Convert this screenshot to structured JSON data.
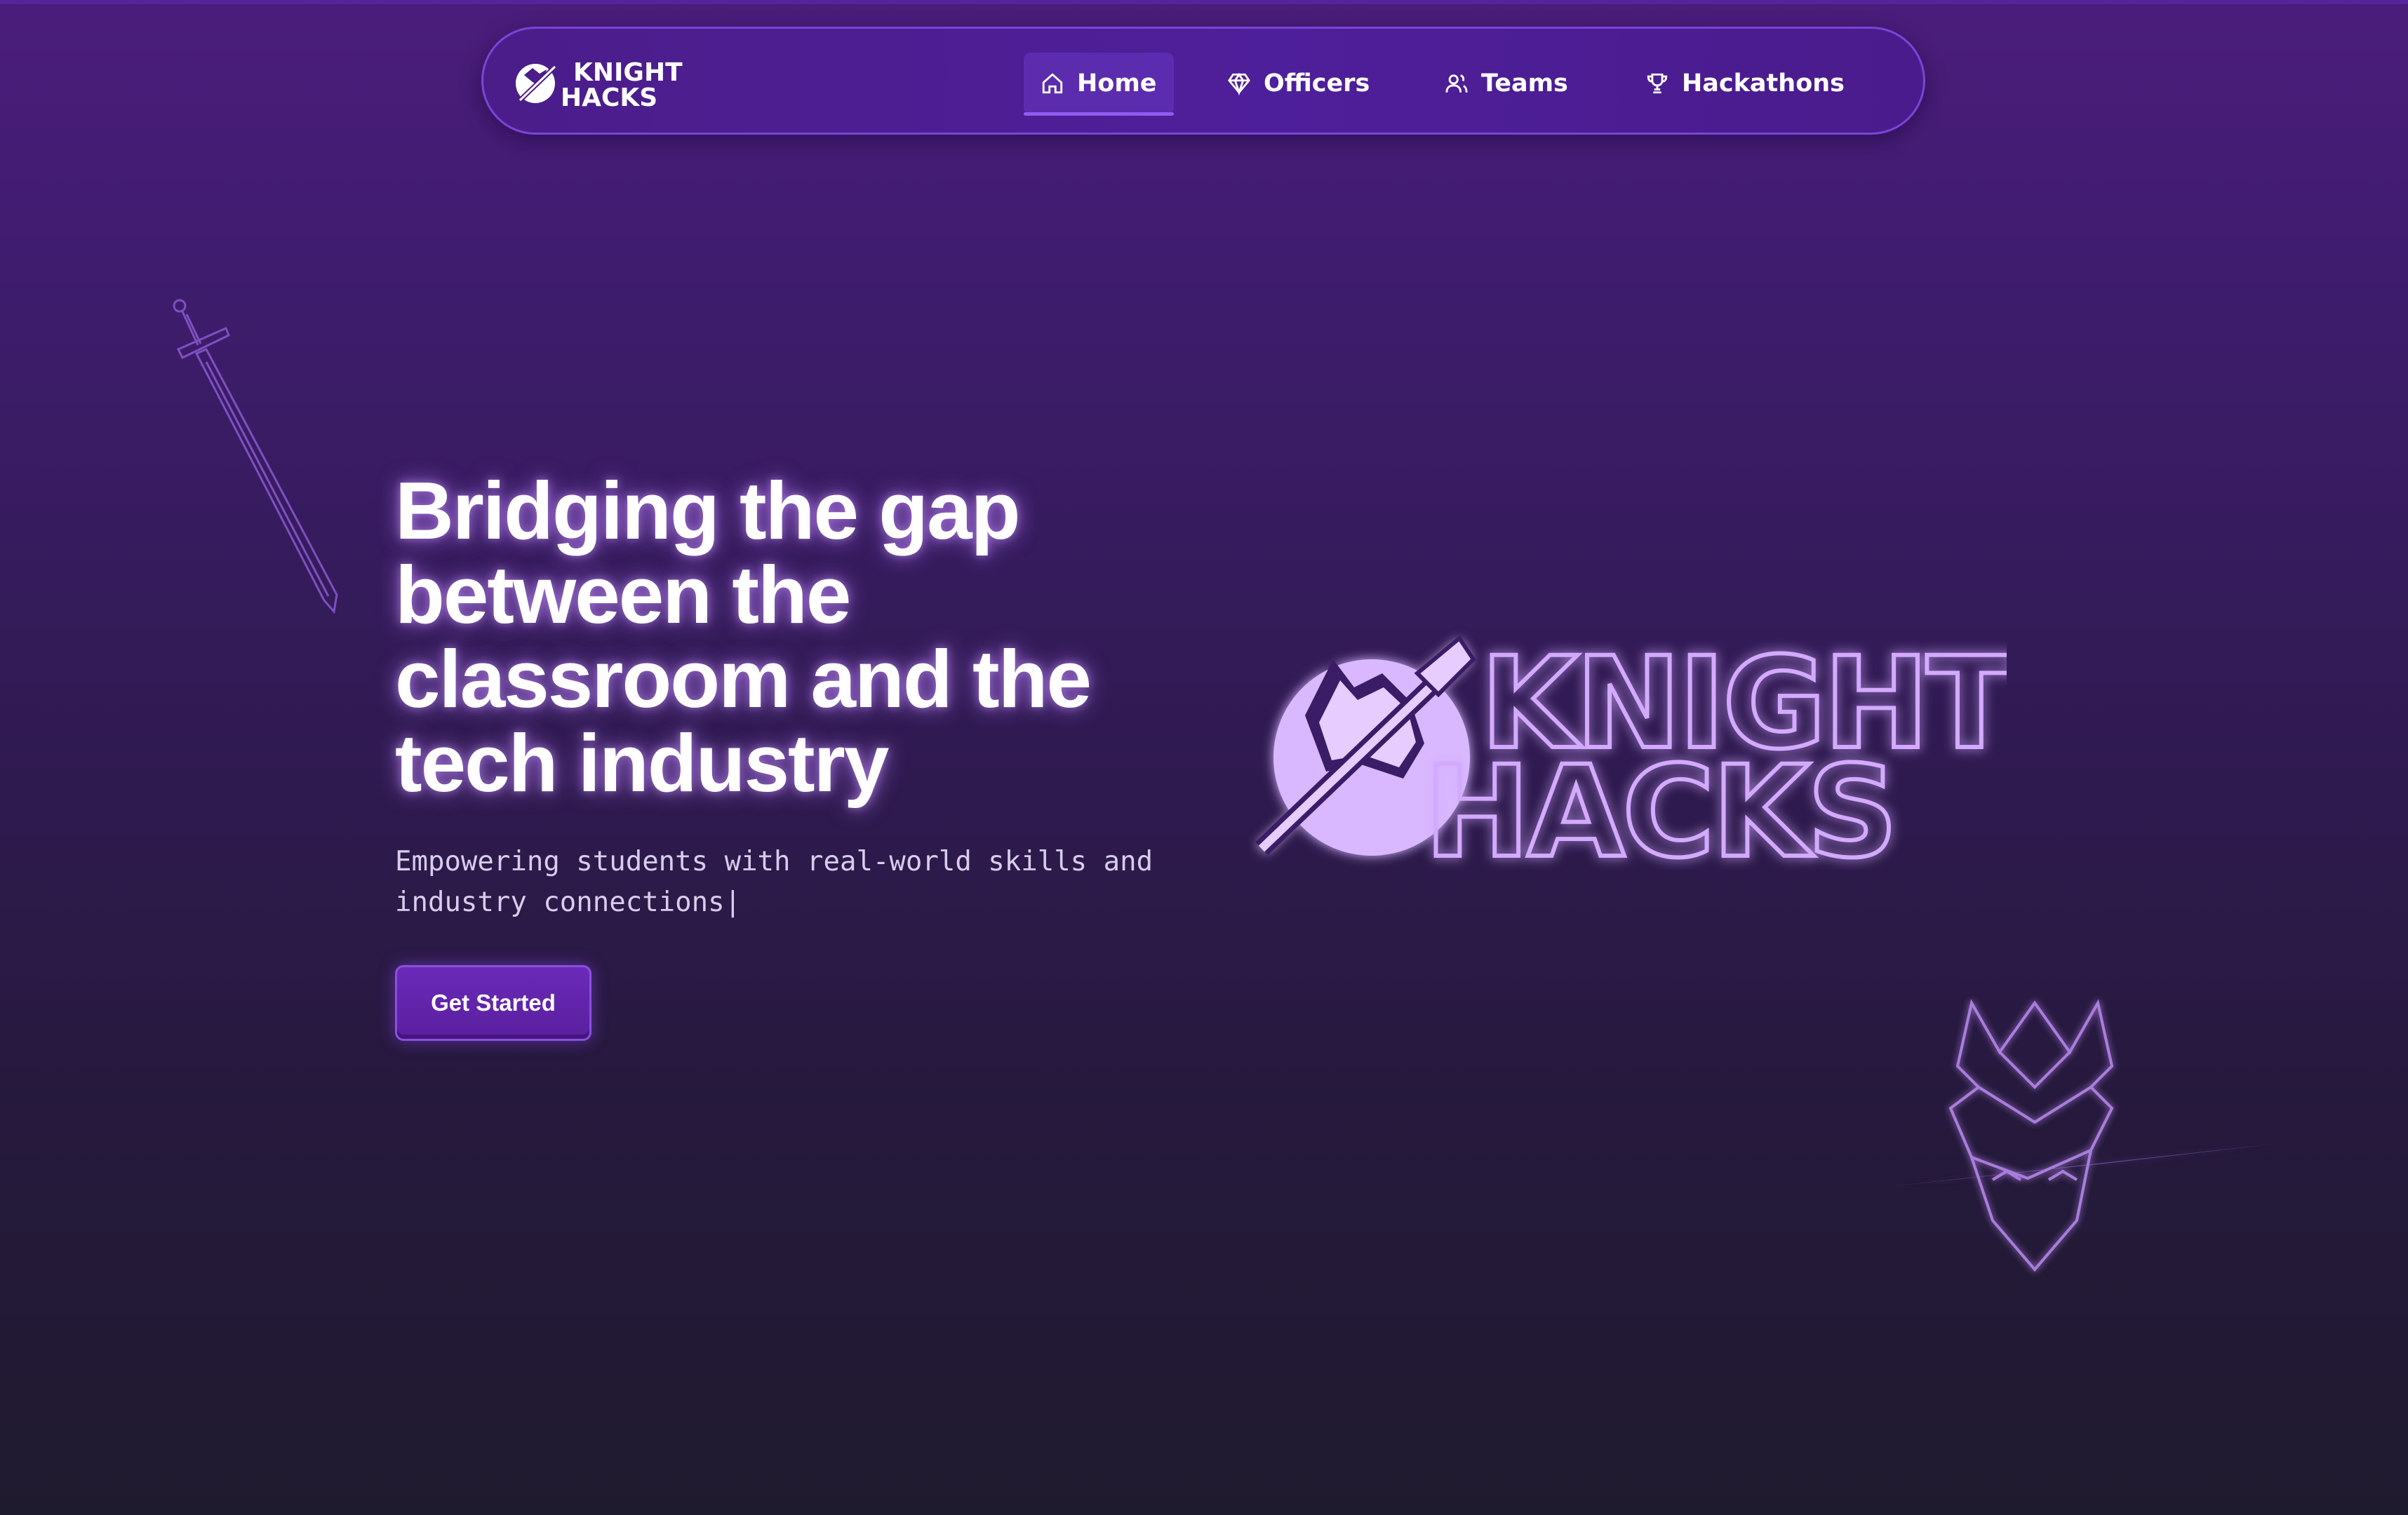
{
  "nav": {
    "logo_text_line1": "KNIGHT",
    "logo_text_line2": "HACKS",
    "items": [
      {
        "label": "Home",
        "icon": "home-icon",
        "active": true
      },
      {
        "label": "Officers",
        "icon": "gem-icon",
        "active": false
      },
      {
        "label": "Teams",
        "icon": "users-icon",
        "active": false
      },
      {
        "label": "Hackathons",
        "icon": "trophy-icon",
        "active": false
      }
    ]
  },
  "hero": {
    "title": "Bridging the gap between the classroom and the tech industry",
    "subtitle": "Empowering students with real-world skills and industry connections",
    "cursor": "|",
    "cta_label": "Get Started"
  },
  "hero_logo": {
    "line1": "KNIGHT",
    "line2": "HACKS"
  },
  "colors": {
    "accent": "#7a45d6",
    "glow": "#c99bff",
    "background_top": "#4b1d7c",
    "background_bottom": "#1f1b2e"
  }
}
